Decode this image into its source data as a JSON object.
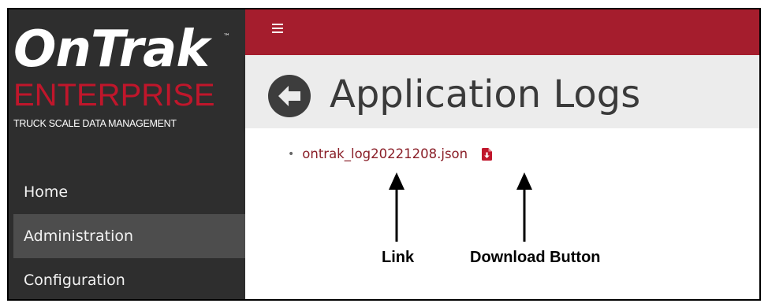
{
  "sidebar": {
    "logo_main": "OnTrak",
    "logo_tm": "™",
    "logo_sub": "ENTERPRISE",
    "logo_tag": "TRUCK SCALE DATA MANAGEMENT",
    "items": [
      {
        "label": "Home",
        "active": false
      },
      {
        "label": "Administration",
        "active": true
      },
      {
        "label": "Configuration",
        "active": false
      }
    ]
  },
  "header": {
    "menu_icon": "hamburger-icon",
    "back_icon": "back-arrow-icon",
    "title": "Application Logs"
  },
  "logs": {
    "files": [
      {
        "name": "ontrak_log20221208.json",
        "download_icon": "file-download-icon"
      }
    ]
  },
  "annotations": {
    "link_label": "Link",
    "download_label": "Download Button"
  },
  "colors": {
    "brand_red": "#a51d2d",
    "logo_red": "#c0162b",
    "sidebar_bg": "#2e2e2e",
    "sidebar_active": "#4d4d4d",
    "title_bar": "#ececec",
    "link": "#8a1f28"
  }
}
